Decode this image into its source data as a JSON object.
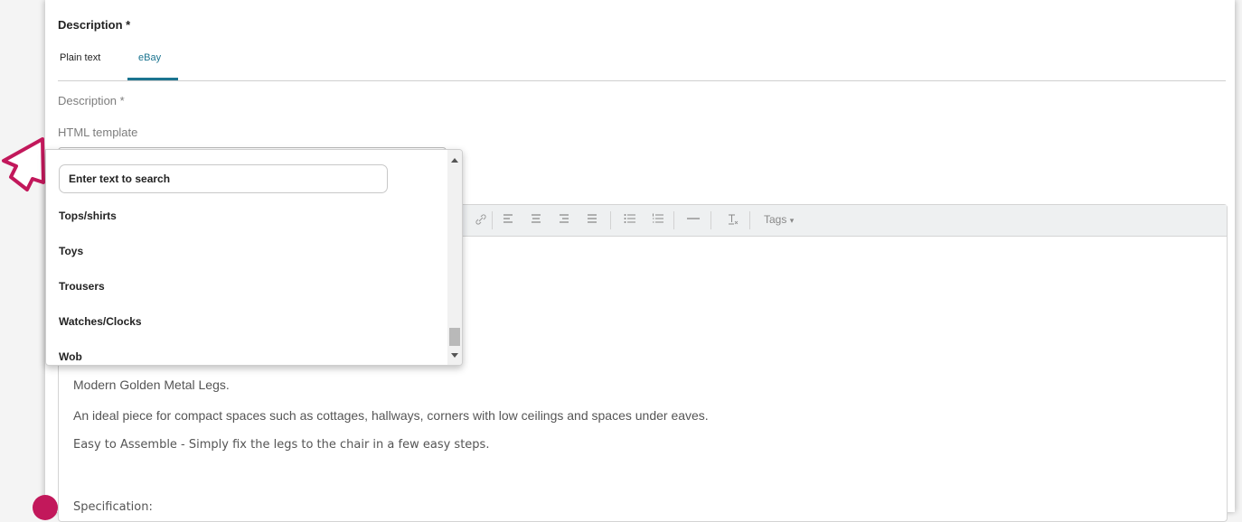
{
  "section": {
    "title": "Description *"
  },
  "tabs": [
    {
      "label": "Plain text",
      "active": false
    },
    {
      "label": "eBay",
      "active": true
    }
  ],
  "fields": {
    "description_label": "Description *",
    "html_template_label": "HTML template"
  },
  "dropdown": {
    "search_placeholder": "Enter text to search",
    "options": [
      "Tops/shirts",
      "Toys",
      "Trousers",
      "Watches/Clocks",
      "Wob"
    ]
  },
  "toolbar": {
    "buttons": [
      "link-icon",
      "align-left-icon",
      "align-center-icon",
      "align-right-icon",
      "align-justify-icon",
      "bullet-list-icon",
      "numbered-list-icon",
      "horizontal-rule-icon",
      "clear-format-icon"
    ],
    "tags_label": "Tags"
  },
  "editor": {
    "lines": [
      "Modern Golden Metal Legs.",
      "An ideal piece for compact spaces such as cottages, hallways, corners with low ceilings and spaces under eaves.",
      "Easy to Assemble - Simply fix the legs to the chair in a few easy steps.",
      "Specification:"
    ]
  },
  "colors": {
    "accent": "#1b7490",
    "cursor": "#c2185b"
  }
}
